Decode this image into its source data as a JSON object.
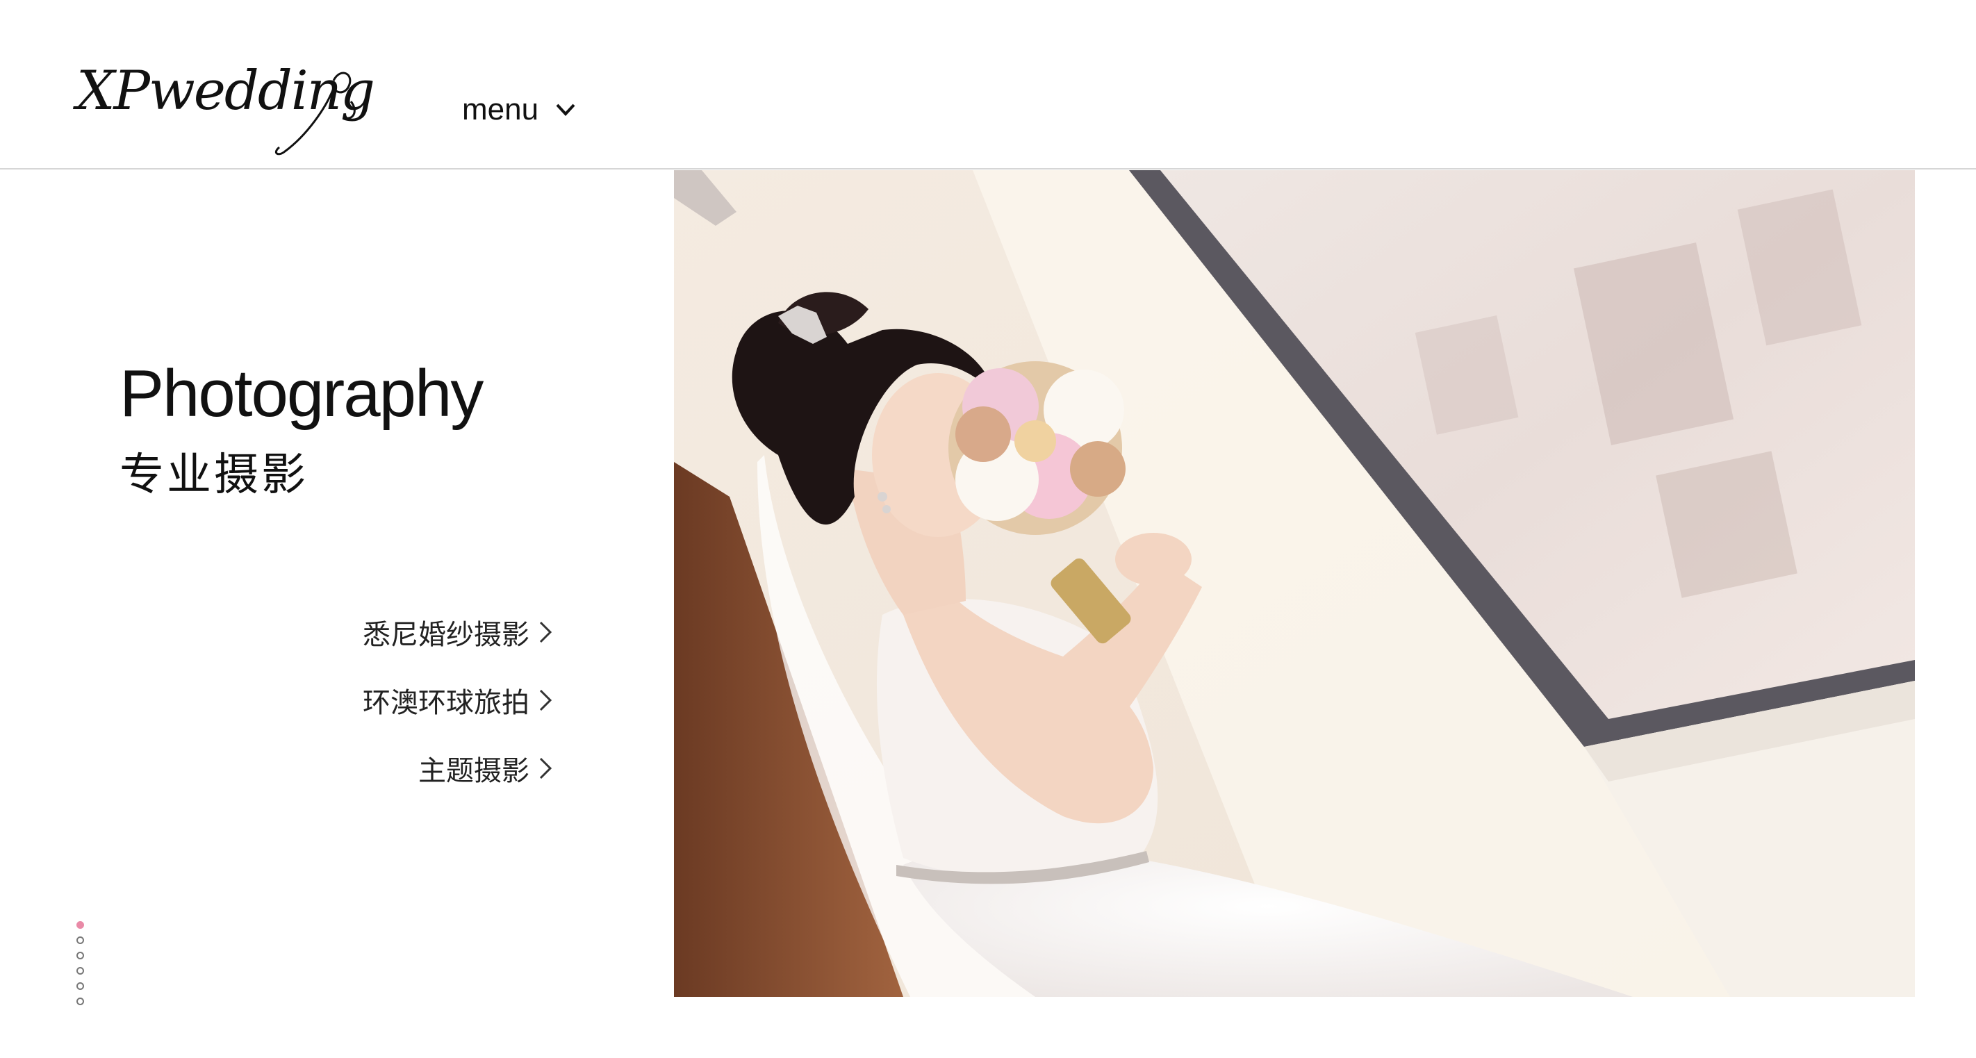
{
  "header": {
    "logo_text": "XPwedding",
    "menu_label": "menu"
  },
  "hero": {
    "title_en": "Photography",
    "title_zh": "专业摄影"
  },
  "services": [
    {
      "label": "悉尼婚纱摄影"
    },
    {
      "label": "环澳环球旅拍"
    },
    {
      "label": "主题摄影"
    }
  ],
  "pager": {
    "total": 6,
    "active_index": 0
  },
  "colors": {
    "accent": "#e98aa7",
    "divider": "#d6d6d6",
    "text": "#111111"
  },
  "icons": {
    "menu": "chevron-down-icon",
    "service": "chevron-right-icon"
  }
}
